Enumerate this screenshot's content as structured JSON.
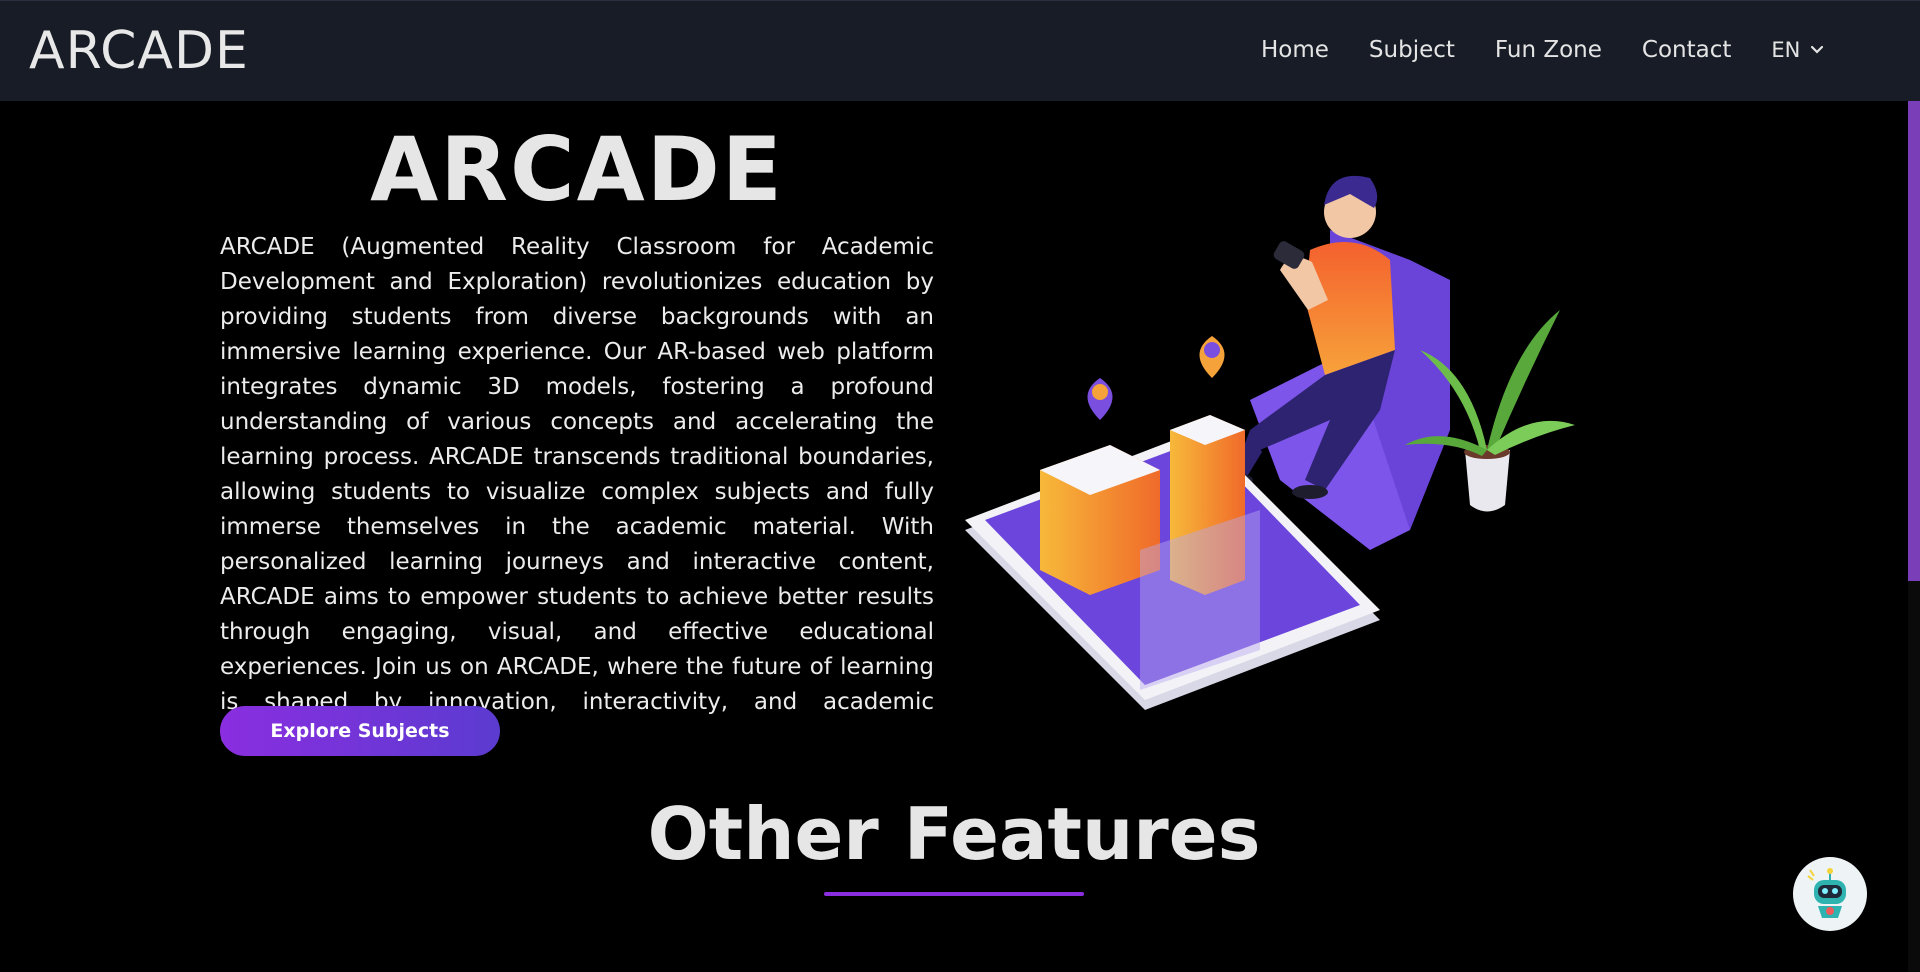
{
  "nav": {
    "brand": "ARCADE",
    "links": [
      "Home",
      "Subject",
      "Fun Zone",
      "Contact"
    ],
    "language": "EN"
  },
  "hero": {
    "title": "ARCADE",
    "description": "ARCADE (Augmented Reality Classroom for Academic Development and Exploration) revolutionizes education by providing students from diverse backgrounds with an immersive learning experience. Our AR-based web platform integrates dynamic 3D models, fostering a profound understanding of various concepts and accelerating the learning process. ARCADE transcends traditional boundaries, allowing students to visualize complex subjects and fully immerse themselves in the academic material. With personalized learning journeys and interactive content, ARCADE aims to empower students to achieve better results through engaging, visual, and effective educational experiences. Join us on ARCADE, where the future of learning is shaped by innovation, interactivity, and academic excellence.",
    "button": "Explore Subjects"
  },
  "features": {
    "title": "Other Features"
  },
  "colors": {
    "accent": "#8a2ee0",
    "navbar": "#171c26",
    "background": "#000000"
  },
  "icons": {
    "language_dropdown": "chevron-down-icon",
    "chat": "robot-chatbot-icon"
  }
}
